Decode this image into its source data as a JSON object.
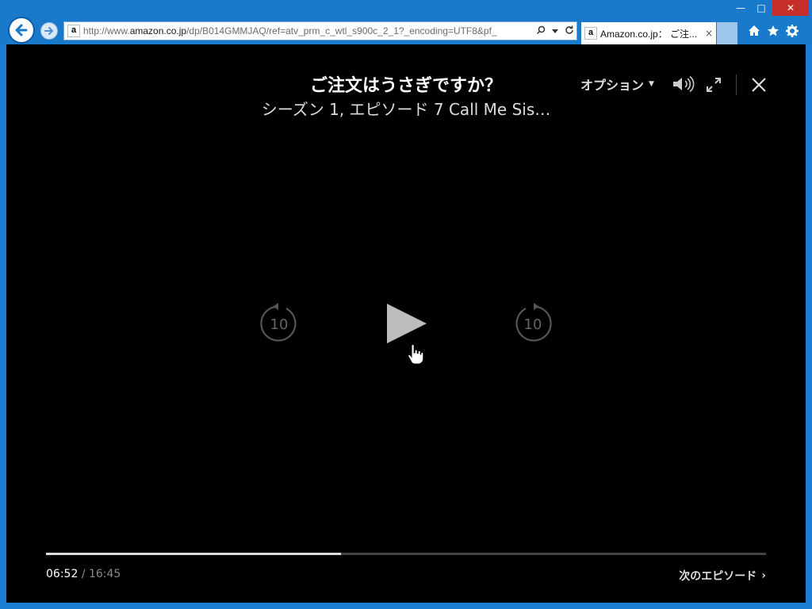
{
  "browser": {
    "url_prefix": "http://www.",
    "url_domain": "amazon.co.jp",
    "url_rest": "/dp/B014GMMJAQ/ref=atv_prm_c_wtl_s900c_2_1?_encoding=UTF8&pf_",
    "favicon_letter": "a",
    "tab_title": "Amazon.co.jp： ご注...",
    "tab_close": "×",
    "window_min": "—",
    "window_max": "□",
    "window_close": "✕"
  },
  "player": {
    "title": "ご注文はうさぎですか？",
    "subtitle": "シーズン 1, エピソード 7 Call Me Sis…",
    "options_label": "オプション",
    "skip_back_label": "10",
    "skip_forward_label": "10",
    "progress": {
      "current": "06:52",
      "separator": "/",
      "duration": "16:45",
      "fraction": 0.41
    },
    "next_episode_label": "次のエピソード",
    "next_episode_chevron": "›"
  },
  "colors": {
    "chrome_blue": "#1979ca",
    "player_bg": "#000000",
    "close_red": "#c7302a"
  }
}
